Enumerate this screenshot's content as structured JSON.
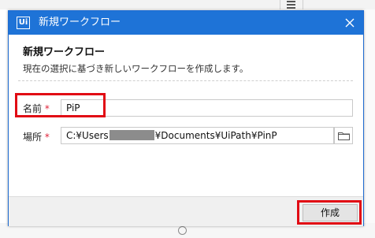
{
  "dialog": {
    "title": "新規ワークフロー",
    "logo_text": "Ui",
    "heading": "新規ワークフロー",
    "description": "現在の選択に基づき新しいワークフローを作成します。"
  },
  "form": {
    "name": {
      "label": "名前",
      "required_mark": "*",
      "value": "PiP"
    },
    "location": {
      "label": "場所",
      "required_mark": "*",
      "value_prefix": "C:¥Users",
      "value_suffix": "¥Documents¥UiPath¥PinP"
    }
  },
  "buttons": {
    "create_label": "作成"
  },
  "colors": {
    "titlebar": "#1e73d7",
    "required": "#e0243a",
    "highlight": "#e10a14"
  },
  "icons": [
    "app-logo-icon",
    "close-icon",
    "folder-icon",
    "menu-icon",
    "info-icon"
  ]
}
